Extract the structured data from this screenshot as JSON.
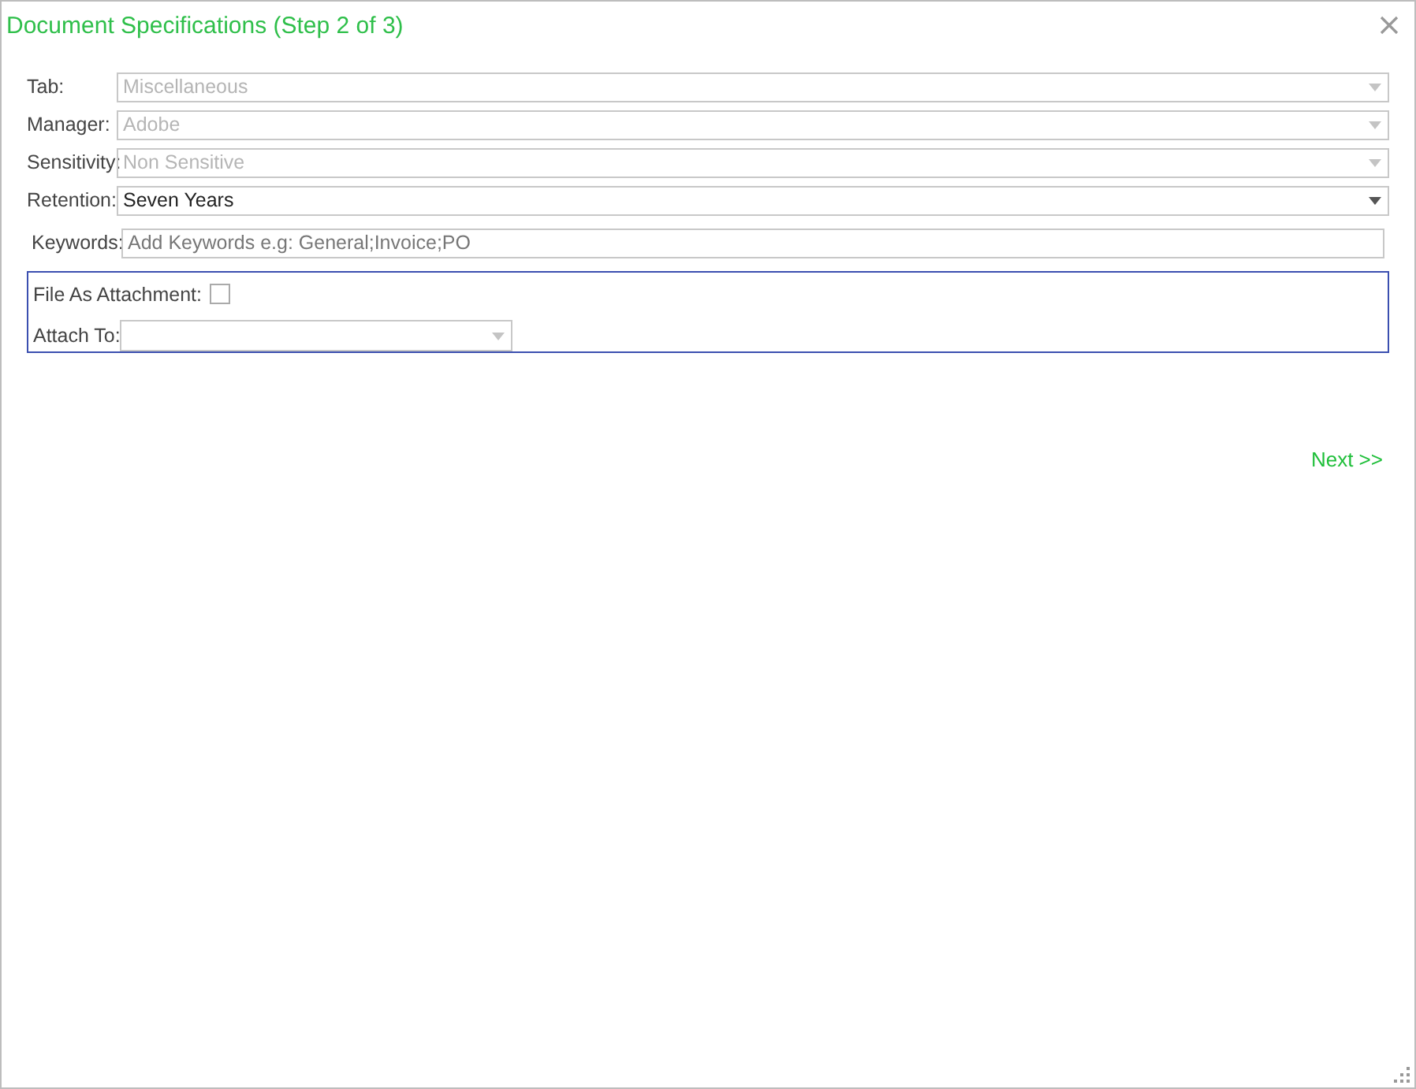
{
  "dialog": {
    "title": "Document Specifications (Step 2 of 3)"
  },
  "fields": [
    {
      "label": "Tab:",
      "value": "Miscellaneous",
      "disabled": true
    },
    {
      "label": "Manager:",
      "value": "Adobe",
      "disabled": true
    },
    {
      "label": "Sensitivity:",
      "value": "Non Sensitive",
      "disabled": true
    },
    {
      "label": "Retention:",
      "value": "Seven Years",
      "disabled": false
    }
  ],
  "keywords": {
    "label": "Keywords:",
    "placeholder": "Add Keywords e.g: General;Invoice;PO"
  },
  "attachment": {
    "file_label": "File As Attachment:",
    "checked": false,
    "attach_label": "Attach To:"
  },
  "next": "Next >>"
}
